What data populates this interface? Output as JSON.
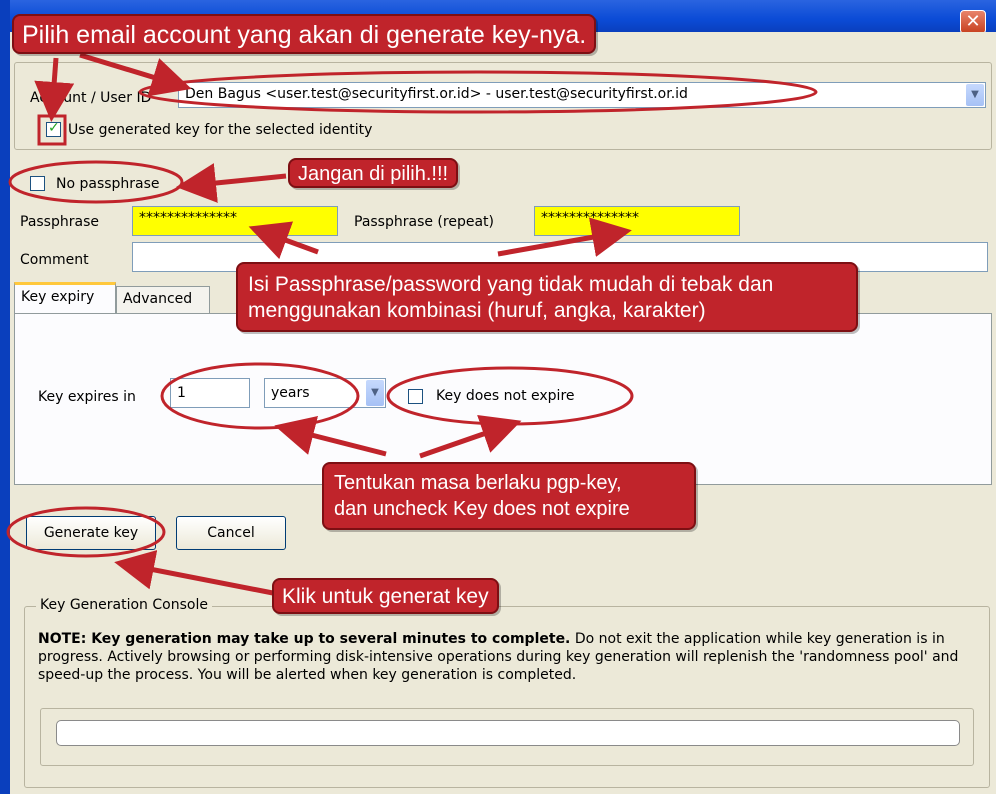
{
  "window": {
    "close_glyph": "✕"
  },
  "identity": {
    "account_label": "Account / User ID",
    "account_value": "Den Bagus <user.test@securityfirst.or.id> - user.test@securityfirst.or.id",
    "use_generated_key_label": "Use generated key for the selected identity",
    "use_generated_key_checked": true
  },
  "passphrase": {
    "no_passphrase_label": "No passphrase",
    "no_passphrase_checked": false,
    "passphrase_label": "Passphrase",
    "passphrase_value": "**************",
    "repeat_label": "Passphrase (repeat)",
    "repeat_value": "**************",
    "comment_label": "Comment",
    "comment_value": ""
  },
  "tabs": [
    {
      "label": "Key expiry",
      "active": true
    },
    {
      "label": "Advanced",
      "active": false
    }
  ],
  "expiry": {
    "expires_in_label": "Key expires in",
    "amount": "1",
    "unit": "years",
    "not_expire_label": "Key does not expire",
    "not_expire_checked": false
  },
  "actions": {
    "generate": "Generate key",
    "cancel": "Cancel"
  },
  "console": {
    "legend": "Key Generation Console",
    "note_bold": "NOTE: Key generation may take up to several minutes to complete.",
    "note_text": " Do not exit the application while key generation is in progress. Actively browsing or performing disk-intensive operations during key generation will replenish the 'randomness pool' and speed-up the process. You will be alerted when key generation is completed.",
    "progress": 0
  },
  "annotations": {
    "pilih_email": "Pilih email account yang akan di generate key-nya.",
    "jangan": "Jangan di pilih.!!!",
    "isi_line1": "Isi Passphrase/password yang tidak mudah di tebak dan",
    "isi_line2": "menggunakan kombinasi (huruf, angka, karakter)",
    "tentukan_line1": "Tentukan masa berlaku pgp-key,",
    "tentukan_line2": "dan uncheck Key does not expire",
    "klik": "Klik untuk generat key",
    "color": "#c0242b"
  },
  "icons": {
    "check": "checkmark-icon",
    "dropdown": "chevron-down-icon",
    "close": "close-icon"
  }
}
